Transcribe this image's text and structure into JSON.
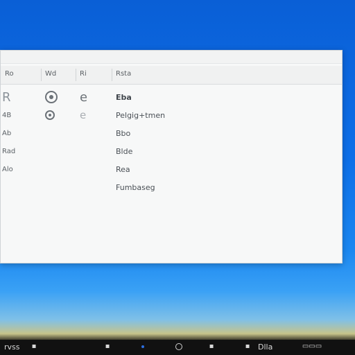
{
  "window": {
    "header": [
      "Ro",
      "Wd",
      "Ri",
      "Rsta"
    ],
    "colA": [
      "R",
      "4B",
      "Ab",
      "Rad",
      "Alo"
    ],
    "colB": [
      "@",
      "@"
    ],
    "colC": [
      "e",
      "e"
    ],
    "colD": [
      "Eba",
      "Pelgig+tmen",
      "Bbo",
      "Blde",
      "Rea",
      "Fumbaseg"
    ]
  },
  "taskbar": {
    "left_label": "rvss",
    "right_label": "Dlla"
  },
  "colors": {
    "accent": "#2d6fe0",
    "desktop": "#0d6fe8"
  }
}
